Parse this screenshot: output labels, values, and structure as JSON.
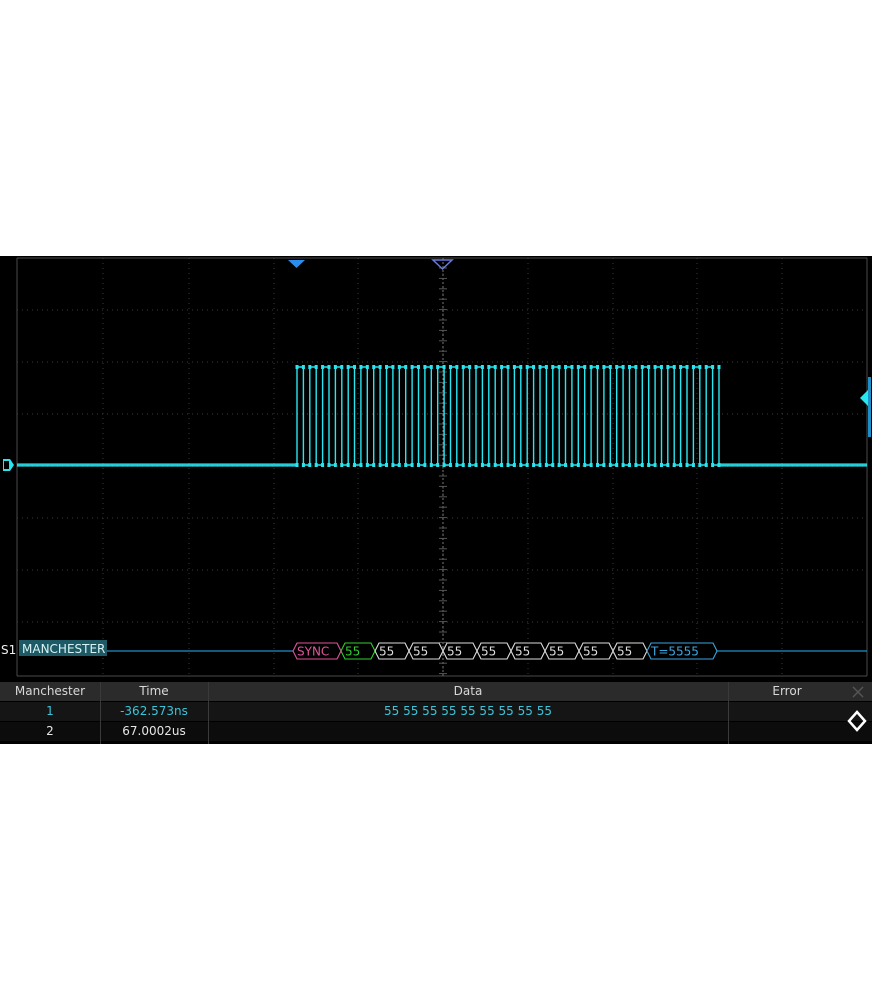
{
  "channel": {
    "label": "S1",
    "bus_name": "MANCHESTER"
  },
  "decode_frames": [
    {
      "text": "SYNC",
      "color": "#e0559c"
    },
    {
      "text": "55",
      "color": "#2fd12f"
    },
    {
      "text": "55",
      "color": "#dddddd"
    },
    {
      "text": "55",
      "color": "#dddddd"
    },
    {
      "text": "55",
      "color": "#dddddd"
    },
    {
      "text": "55",
      "color": "#dddddd"
    },
    {
      "text": "55",
      "color": "#dddddd"
    },
    {
      "text": "55",
      "color": "#dddddd"
    },
    {
      "text": "55",
      "color": "#dddddd"
    },
    {
      "text": "55",
      "color": "#dddddd"
    },
    {
      "text": "T=5555",
      "color": "#3aa6e0"
    }
  ],
  "table": {
    "headers": [
      "Manchester",
      "Time",
      "Data",
      "Error"
    ],
    "rows": [
      [
        "1",
        "-362.573ns",
        "55 55 55 55 55 55 55 55 55",
        ""
      ],
      [
        "2",
        "67.0002us",
        "",
        ""
      ]
    ]
  },
  "colors": {
    "trace": "#28e6f0",
    "bus_line": "#1f8fc8",
    "marker": "#2a8df0",
    "grid": "#3a3a3a"
  },
  "icons": {
    "close": "close-icon",
    "navigate": "navigate-diamond-icon"
  }
}
